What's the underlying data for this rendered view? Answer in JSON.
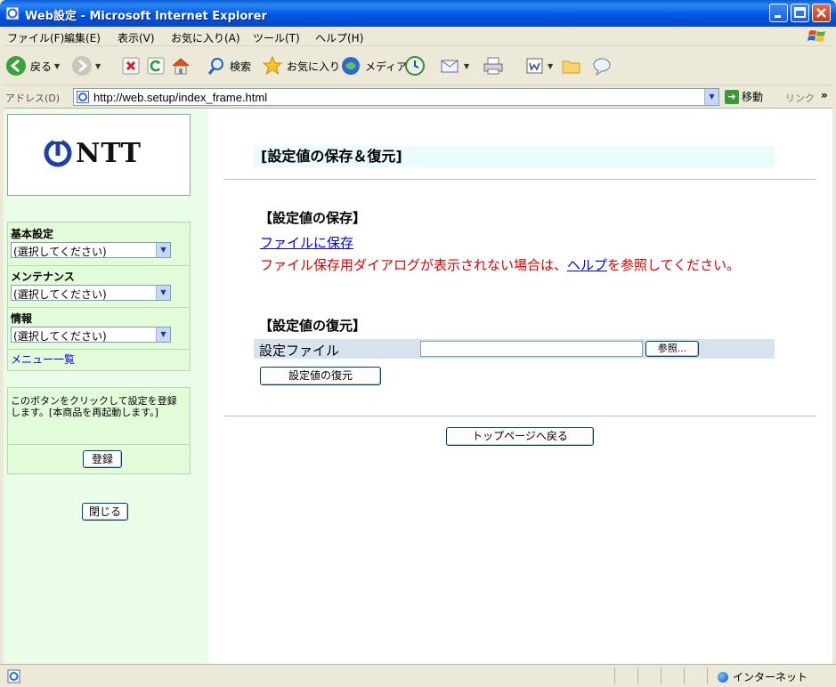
{
  "window": {
    "title": "Web設定 - Microsoft Internet Explorer"
  },
  "menubar": {
    "items": [
      "ファイル(F)",
      "編集(E)",
      "表示(V)",
      "お気に入り(A)",
      "ツール(T)",
      "ヘルプ(H)"
    ]
  },
  "toolbar": {
    "back": "戻る",
    "search": "検索",
    "favorites": "お気に入り",
    "media": "メディア"
  },
  "address": {
    "label": "アドレス(D)",
    "url": "http://web.setup/index_frame.html",
    "go": "移動",
    "links": "リンク",
    "more": "»"
  },
  "sidebar": {
    "logo_text": "NTT",
    "groups": [
      {
        "label": "基本設定",
        "selected": "(選択してください)"
      },
      {
        "label": "メンテナンス",
        "selected": "(選択してください)"
      },
      {
        "label": "情報",
        "selected": "(選択してください)"
      }
    ],
    "menu_link": "メニュー一覧",
    "register_desc": "このボタンをクリックして設定を登録します。[本商品を再起動します。]",
    "register_button": "登録",
    "close_button": "閉じる"
  },
  "main": {
    "title": "[設定値の保存＆復元]",
    "save_heading": "【設定値の保存】",
    "save_link": "ファイルに保存",
    "save_note_before": "ファイル保存用ダイアログが表示されない場合は、",
    "save_note_link": "ヘルプ",
    "save_note_after": "を参照してください。",
    "restore_heading": "【設定値の復元】",
    "restore_label": "設定ファイル",
    "browse_button": "参照...",
    "restore_button": "設定値の復元",
    "top_button": "トップページへ戻る"
  },
  "statusbar": {
    "zone": "インターネット"
  },
  "colors": {
    "titlebar": "#0055e5",
    "sidebar_bg": "#e9fde9",
    "panel_bg": "#e2fbd9",
    "title_bg": "#eafafd",
    "row_bg": "#d6e3ef",
    "note_red": "#e00000",
    "link_blue": "#0000ee"
  }
}
